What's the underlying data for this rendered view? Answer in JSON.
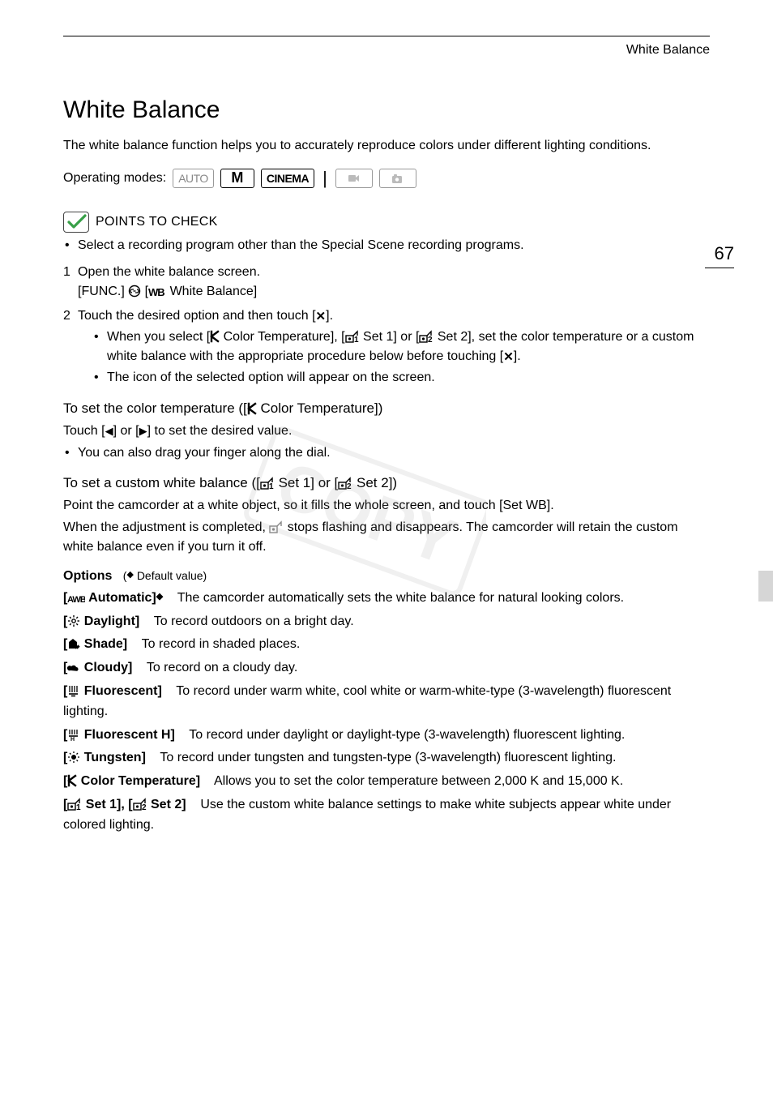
{
  "header": {
    "running": "White Balance"
  },
  "pageNumber": "67",
  "title": "White Balance",
  "intro": "The white balance function helps you to accurately reproduce colors under different lighting conditions.",
  "operatingModesLabel": "Operating modes:",
  "modes": {
    "auto": "AUTO",
    "manual": "M",
    "cinema": "CINEMA"
  },
  "pointsToCheck": {
    "label": "POINTS TO CHECK",
    "items": [
      "Select a recording program other than the Special Scene recording programs."
    ]
  },
  "steps": {
    "one": {
      "num": "1",
      "head": "Open the white balance screen.",
      "sub_pre": "[FUNC.] ",
      "sub_post": " White Balance]"
    },
    "two": {
      "num": "2",
      "head_pre": "Touch the desired option and then touch [",
      "head_post": "].",
      "bullets": {
        "b1_a": "When you select [",
        "b1_b": " Color Temperature], [",
        "b1_c": " Set 1] or [",
        "b1_d": " Set 2], set the color temperature or a custom white balance with the appropriate procedure below before touching [",
        "b1_e": "].",
        "b2": "The icon of the selected option will appear on the screen."
      }
    }
  },
  "colorTemp": {
    "head_pre": "To set the color temperature ([",
    "head_post": " Color Temperature])",
    "line1_pre": "Touch [",
    "line1_mid": "] or [",
    "line1_post": "] to set the desired value.",
    "bullet": "You can also drag your finger along the dial."
  },
  "customWB": {
    "head_pre": "To set a custom white balance ([",
    "head_mid": " Set 1] or [",
    "head_post": " Set 2])",
    "p1": "Point the camcorder at a white object, so it fills the whole screen, and touch [Set WB].",
    "p2_pre": "When the adjustment is completed, ",
    "p2_post": " stops flashing and disappears. The camcorder will retain the custom white balance even if you turn it off."
  },
  "options": {
    "label": "Options",
    "defaultValue": "Default value)",
    "items": {
      "auto": {
        "name": " Automatic]",
        "desc": "The camcorder automatically sets the white balance for natural looking colors."
      },
      "day": {
        "name": " Daylight]",
        "desc": "To record outdoors on a bright day."
      },
      "shade": {
        "name": " Shade]",
        "desc": "To record in shaded places."
      },
      "cloudy": {
        "name": " Cloudy]",
        "desc": "To record on a cloudy day."
      },
      "fluor": {
        "name": " Fluorescent]",
        "desc": "To record under warm white, cool white or warm-white-type (3-wavelength) fluorescent lighting."
      },
      "fluorh": {
        "name": " Fluorescent H]",
        "desc": "To record under daylight or daylight-type (3-wavelength) fluorescent lighting."
      },
      "tung": {
        "name": " Tungsten]",
        "desc": "To record under tungsten and tungsten-type (3-wavelength) fluorescent lighting."
      },
      "ctemp": {
        "name": " Color Temperature]",
        "desc": "Allows you to set the color temperature between 2,000 K and 15,000 K."
      },
      "sets": {
        "name1": " Set 1], [",
        "name2": " Set 2]",
        "desc": "Use the custom white balance settings to make white subjects appear white under colored lighting."
      }
    }
  },
  "watermarkText": "COPY"
}
